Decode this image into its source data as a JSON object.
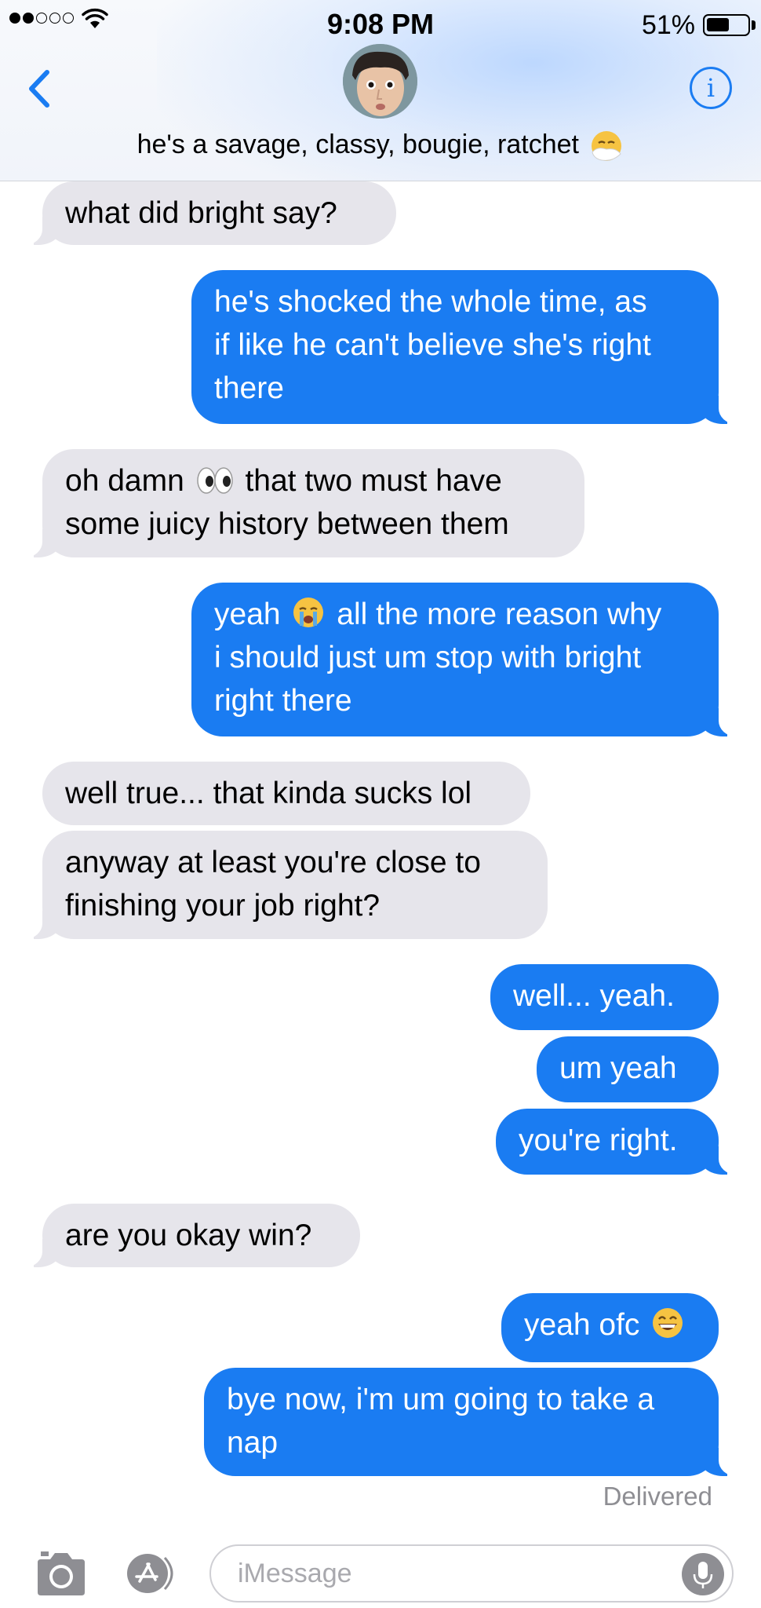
{
  "status_bar": {
    "time": "9:08 PM",
    "battery": "51%",
    "signal_bars": 2,
    "battery_level": 0.51
  },
  "header": {
    "contact_name": "he's a savage, classy, bougie, ratchet",
    "name_emoji": "sneezing-face-emoji"
  },
  "messages": [
    {
      "side": "in",
      "text": "what did bright say?"
    },
    {
      "side": "out",
      "lines": [
        "he's shocked the whole time, as",
        "if like he can't believe she's right",
        "there"
      ]
    },
    {
      "side": "in",
      "line1_before": "oh damn",
      "line1_emoji": "eyes-emoji",
      "line1_after": "that two must have",
      "line2": "some juicy history between them"
    },
    {
      "side": "out",
      "line1_before": "yeah",
      "line1_emoji": "crying-face-emoji",
      "line1_after": "all the more reason why",
      "line2": "i should just um stop with bright",
      "line3": "right there"
    },
    {
      "side": "in",
      "text": "well true... that kinda sucks lol"
    },
    {
      "side": "in",
      "lines": [
        "anyway at least you're close to",
        "finishing your job right?"
      ]
    },
    {
      "side": "out",
      "text": "well... yeah."
    },
    {
      "side": "out",
      "text": "um yeah"
    },
    {
      "side": "out",
      "text": "you're right."
    },
    {
      "side": "in",
      "text": "are you okay win?"
    },
    {
      "side": "out",
      "text": "yeah ofc",
      "emoji": "grinning-face-emoji"
    },
    {
      "side": "out",
      "lines": [
        "bye now, i'm um going to take a",
        "nap"
      ]
    }
  ],
  "delivered_label": "Delivered",
  "input_bar": {
    "placeholder": "iMessage"
  },
  "colors": {
    "accent": "#1a7cf2",
    "incoming_bubble": "#e6e5eb",
    "outgoing_bubble": "#1a7cf2"
  }
}
